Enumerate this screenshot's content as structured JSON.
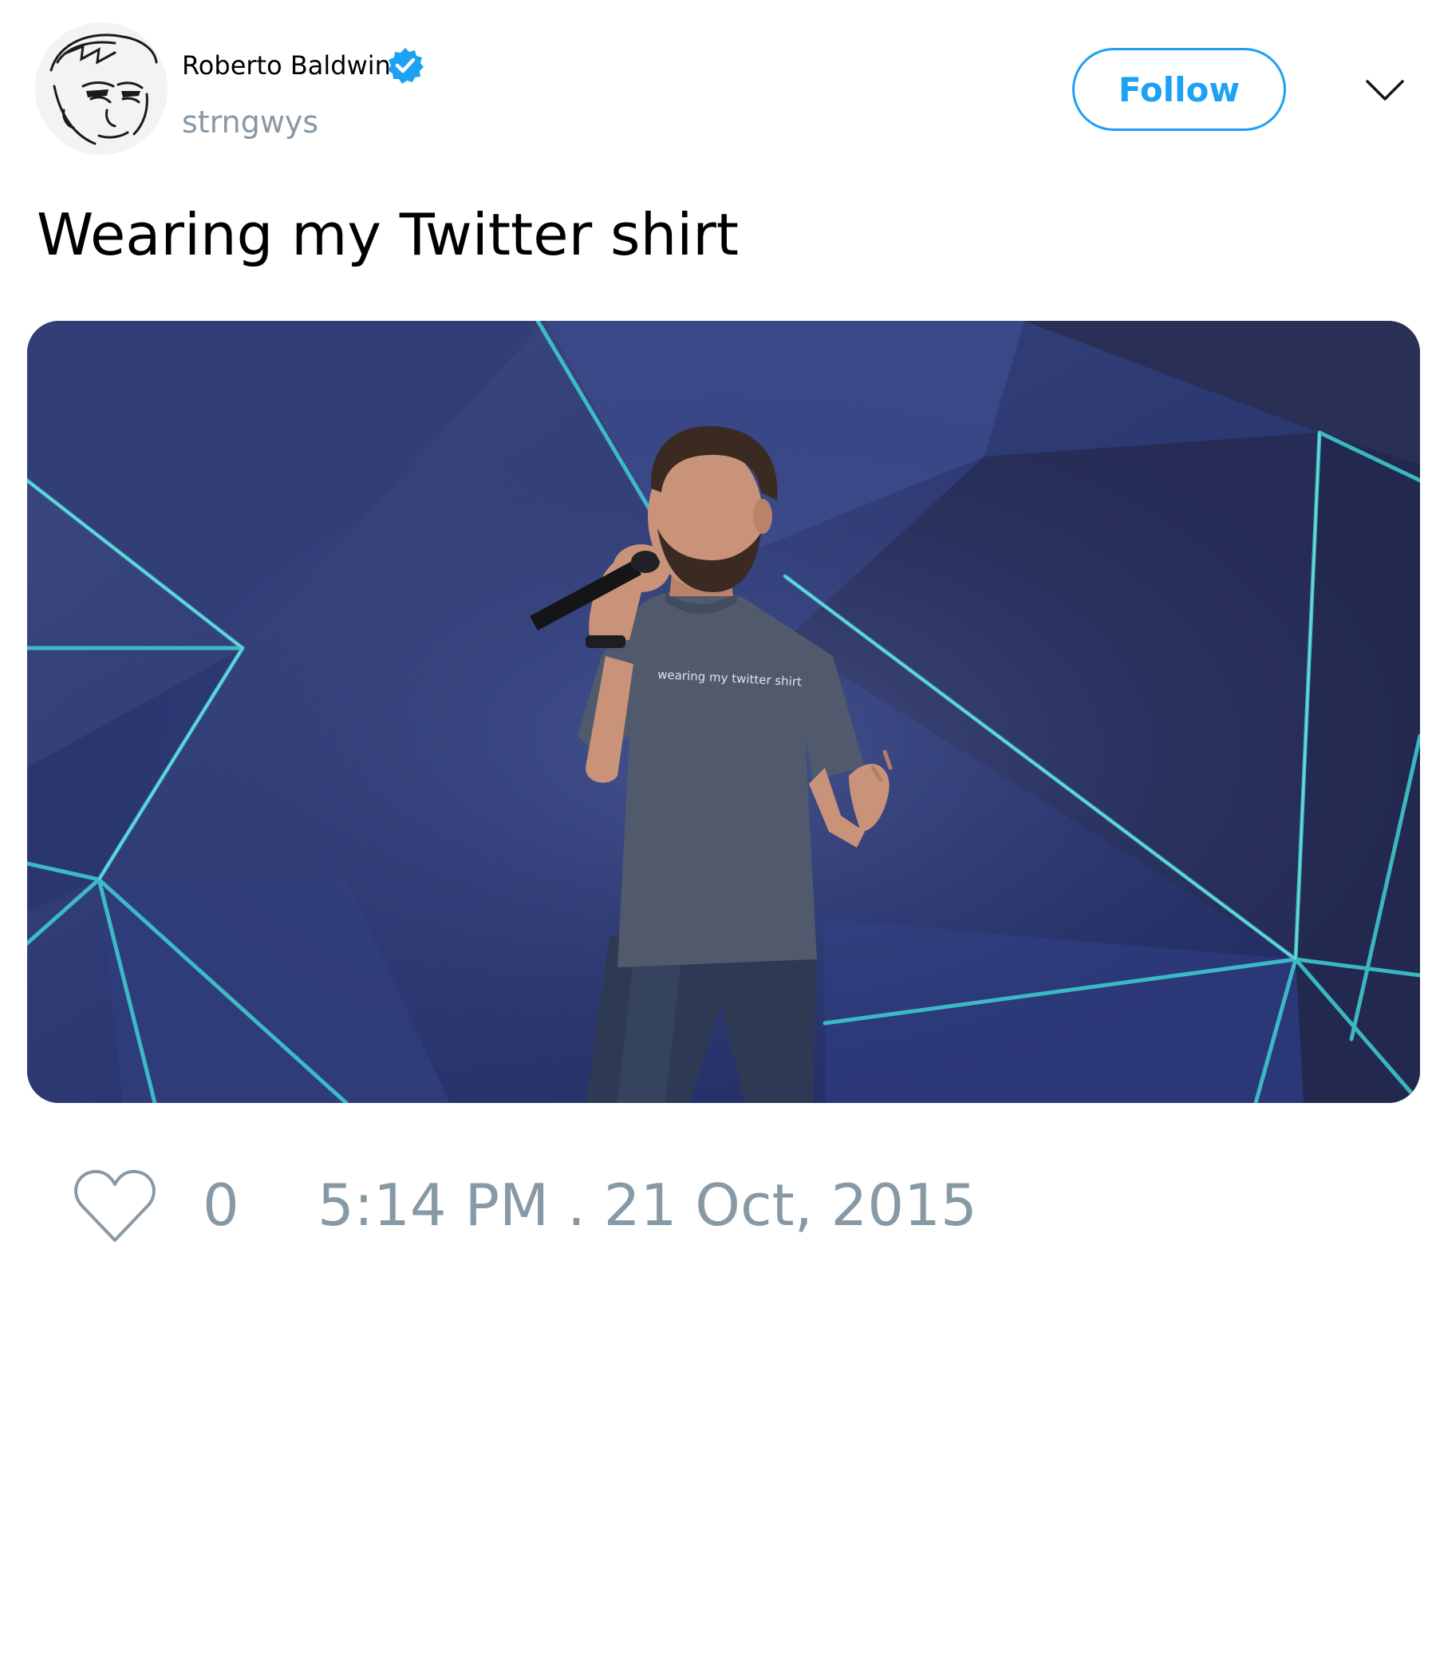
{
  "user": {
    "name": "Roberto Baldwin",
    "handle": "strngwys",
    "verified": true,
    "avatar_icon": "sketch-portrait-avatar"
  },
  "actions": {
    "follow_label": "Follow",
    "menu_icon": "chevron-down-icon"
  },
  "tweet": {
    "text": "Wearing my Twitter shirt",
    "media": {
      "shirt_text": "wearing my twitter shirt"
    }
  },
  "footer": {
    "like_icon": "heart-icon",
    "like_count": "0",
    "timestamp": "5:14 PM . 21 Oct, 2015"
  },
  "colors": {
    "accent": "#1da1f2",
    "muted": "#8899a6",
    "text": "#000000",
    "background": "#ffffff"
  }
}
